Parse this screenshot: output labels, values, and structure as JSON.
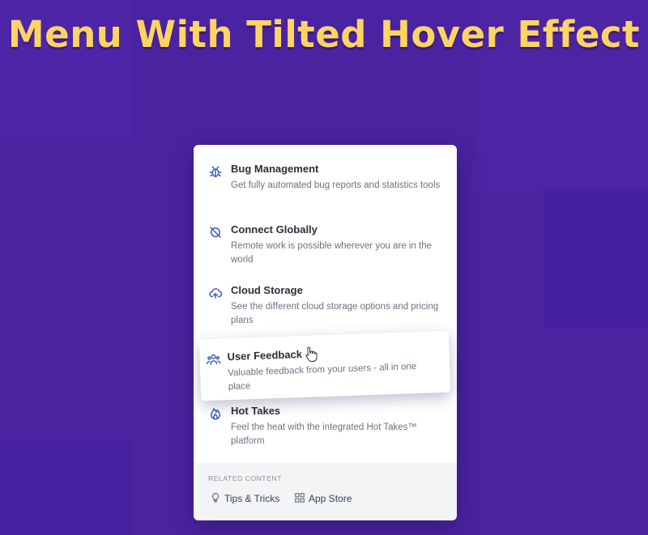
{
  "page": {
    "title": "Menu With Tilted Hover Effect"
  },
  "menu": {
    "items": [
      {
        "label": "Bug Management",
        "description": "Get fully automated bug reports and statistics tools",
        "icon": "bug-icon"
      },
      {
        "label": "Connect Globally",
        "description": "Remote work is possible wherever you are in the world",
        "icon": "planet-icon"
      },
      {
        "label": "Cloud Storage",
        "description": "See the different cloud storage options and pricing plans",
        "icon": "cloud-icon"
      },
      {
        "label": "User Feedback",
        "description": "Valuable feedback from your users - all in one place",
        "icon": "users-icon",
        "state": "hovered"
      },
      {
        "label": "Hot Takes",
        "description": "Feel the heat with the integrated Hot Takes™ platform",
        "icon": "flame-icon"
      }
    ],
    "footer": {
      "heading": "RELATED CONTENT",
      "links": [
        {
          "label": "Tips & Tricks",
          "icon": "lightbulb-icon"
        },
        {
          "label": "App Store",
          "icon": "grid-icon"
        }
      ]
    }
  },
  "colors": {
    "background": "#4a23a0",
    "title": "#fcd462",
    "accent_icon": "#3d5db8"
  }
}
